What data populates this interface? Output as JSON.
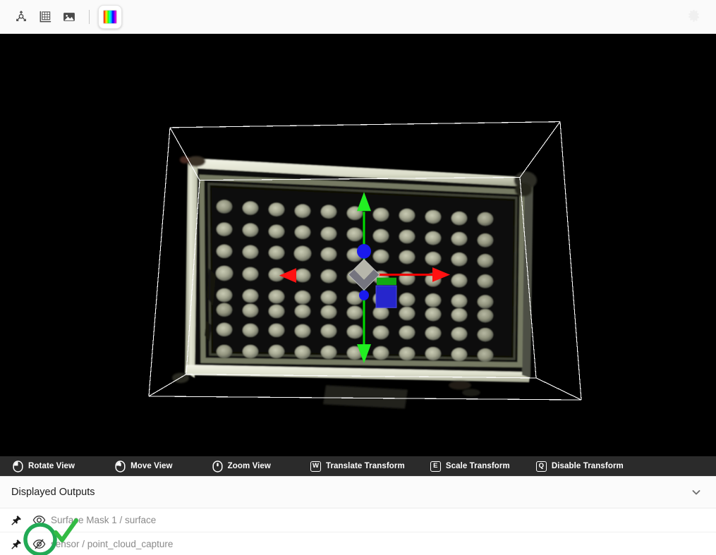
{
  "toolbar": {
    "buttons": [
      {
        "name": "axes-origin-icon",
        "title": "Show Axes"
      },
      {
        "name": "grid-icon",
        "title": "Show Grid"
      },
      {
        "name": "image-icon",
        "title": "Show Image"
      }
    ],
    "active_tool": {
      "name": "color-bar-icon",
      "title": "Color Map"
    },
    "settings": {
      "name": "gear-icon",
      "title": "Settings"
    }
  },
  "viewport": {
    "background": "#000000",
    "bbox_color": "#ffffff",
    "gizmo": {
      "x_axis_color": "#ff0000",
      "y_axis_color": "#00dd00",
      "z_axis_color": "#1a1aff",
      "center_handle_color": "#b0b0b0"
    },
    "scene_description": "point_cloud_capture"
  },
  "shortcuts": [
    {
      "icon": "mouse-left-icon",
      "label": "Rotate View"
    },
    {
      "icon": "mouse-middle-icon",
      "label": "Move View"
    },
    {
      "icon": "mouse-scroll-icon",
      "label": "Zoom View"
    },
    {
      "key": "W",
      "label": "Translate Transform"
    },
    {
      "key": "E",
      "label": "Scale Transform"
    },
    {
      "key": "Q",
      "label": "Disable Transform"
    }
  ],
  "outputs_panel": {
    "title": "Displayed Outputs",
    "collapse_icon": "chevron-down-icon",
    "rows": [
      {
        "pin_icon": "pin-icon",
        "visibility_icon": "eye-icon",
        "label": "Surface Mask 1 / surface",
        "visible": "true"
      },
      {
        "pin_icon": "pin-icon",
        "visibility_icon": "eye-off-icon",
        "label": "sensor / point_cloud_capture",
        "visible": "false"
      }
    ]
  },
  "annotations": {
    "highlight_color": "#22aa55",
    "check_color": "#33bb44",
    "circle_target": "eye-off-icon",
    "check_target": "eye-off-icon"
  }
}
